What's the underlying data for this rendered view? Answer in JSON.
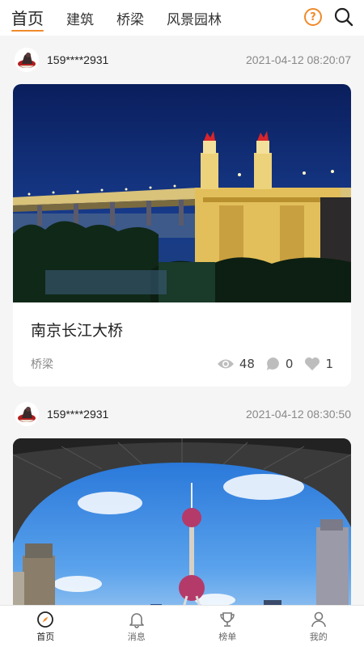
{
  "colors": {
    "accent": "#f08a2c"
  },
  "top_tabs": [
    {
      "label": "首页",
      "active": true
    },
    {
      "label": "建筑",
      "active": false
    },
    {
      "label": "桥梁",
      "active": false
    },
    {
      "label": "风景园林",
      "active": false
    }
  ],
  "top_icons": {
    "help": "question-circle-icon",
    "search": "search-icon",
    "help_glyph": "?"
  },
  "posts": [
    {
      "username": "159****2931",
      "timestamp": "2021-04-12 08:20:07",
      "title": "南京长江大桥",
      "category": "桥梁",
      "views": "48",
      "comments": "0",
      "likes": "1"
    },
    {
      "username": "159****2931",
      "timestamp": "2021-04-12 08:30:50"
    }
  ],
  "bottom_nav": [
    {
      "label": "首页",
      "icon": "compass-icon",
      "active": true
    },
    {
      "label": "消息",
      "icon": "bell-icon",
      "active": false
    },
    {
      "label": "榜单",
      "icon": "trophy-icon",
      "active": false
    },
    {
      "label": "我的",
      "icon": "user-icon",
      "active": false
    }
  ]
}
